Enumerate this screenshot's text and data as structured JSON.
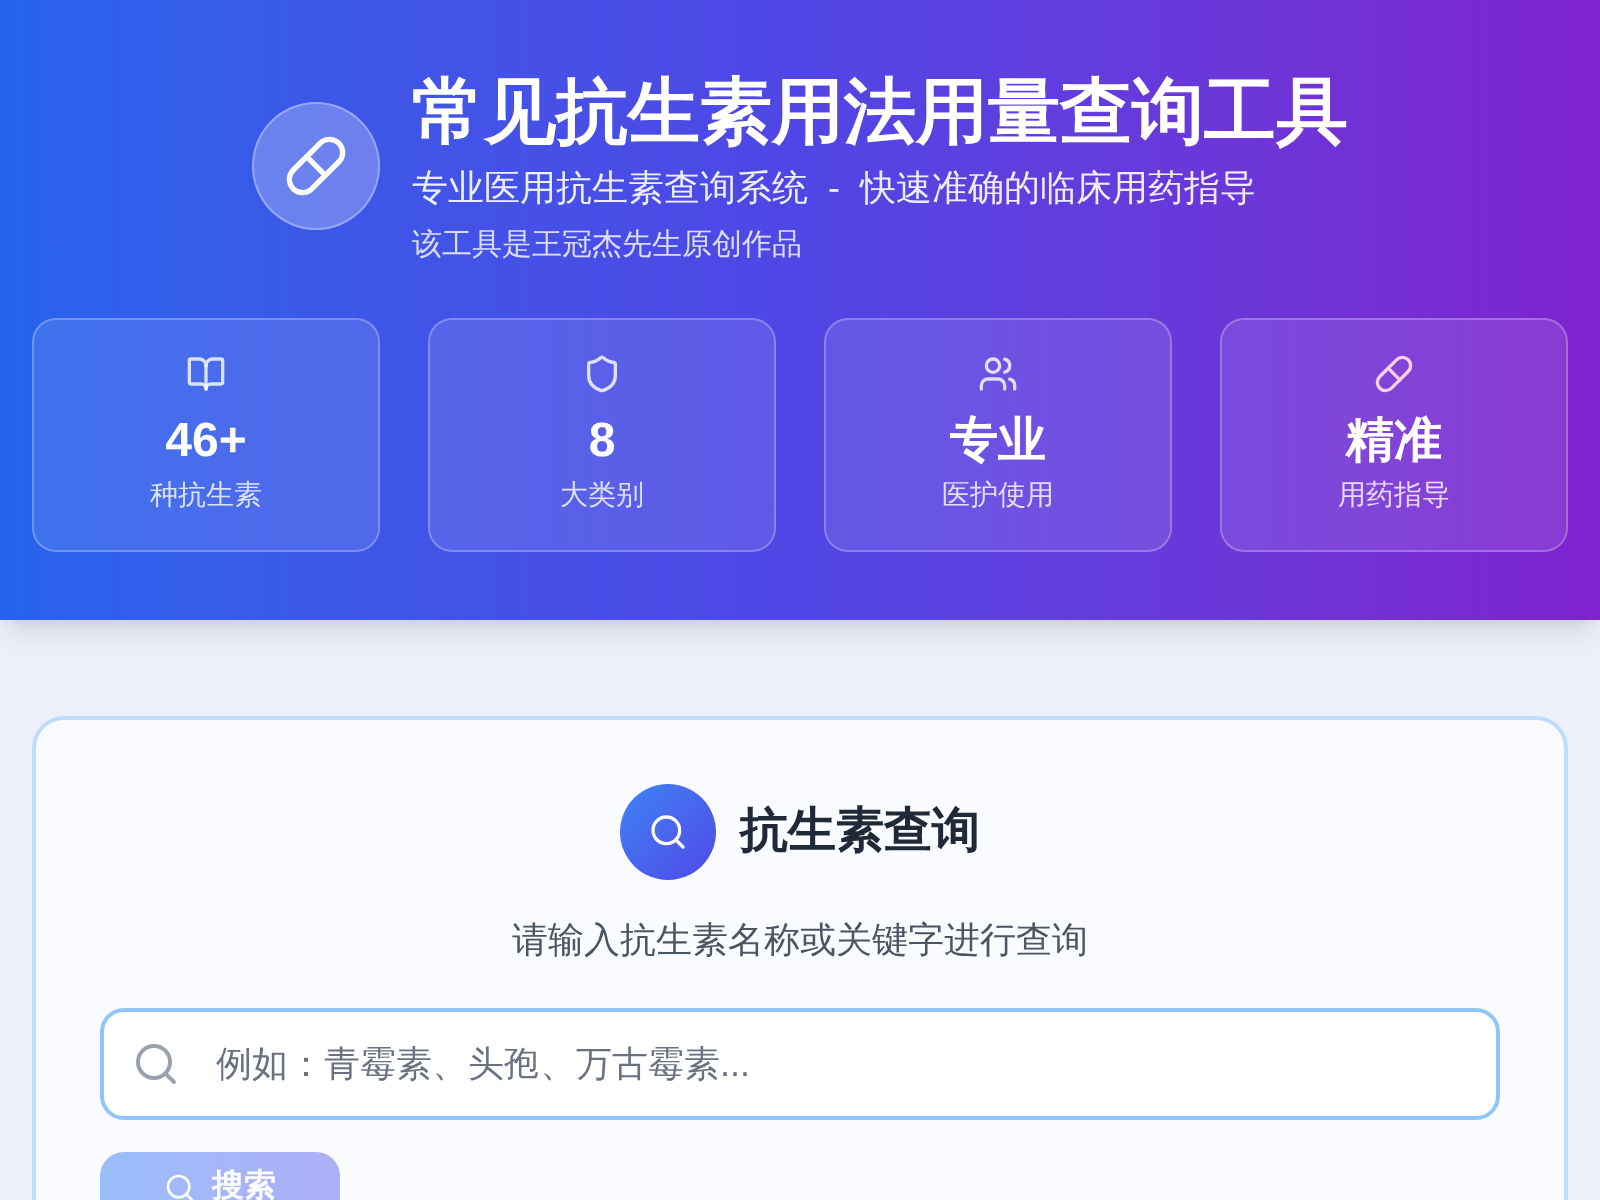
{
  "header": {
    "title": "常见抗生素用法用量查询工具",
    "subtitle": "专业医用抗生素查询系统  -  快速准确的临床用药指导",
    "credit": "该工具是王冠杰先生原创作品"
  },
  "stats": [
    {
      "kind": "book",
      "value": "46+",
      "label": "种抗生素"
    },
    {
      "kind": "shield",
      "value": "8",
      "label": "大类别"
    },
    {
      "kind": "users",
      "value": "专业",
      "label": "医护使用"
    },
    {
      "kind": "pill",
      "value": "精准",
      "label": "用药指导"
    }
  ],
  "search": {
    "title": "抗生素查询",
    "hint": "请输入抗生素名称或关键字进行查询",
    "placeholder": "例如：青霉素、头孢、万古霉素...",
    "button": "搜索",
    "disabled": true
  }
}
